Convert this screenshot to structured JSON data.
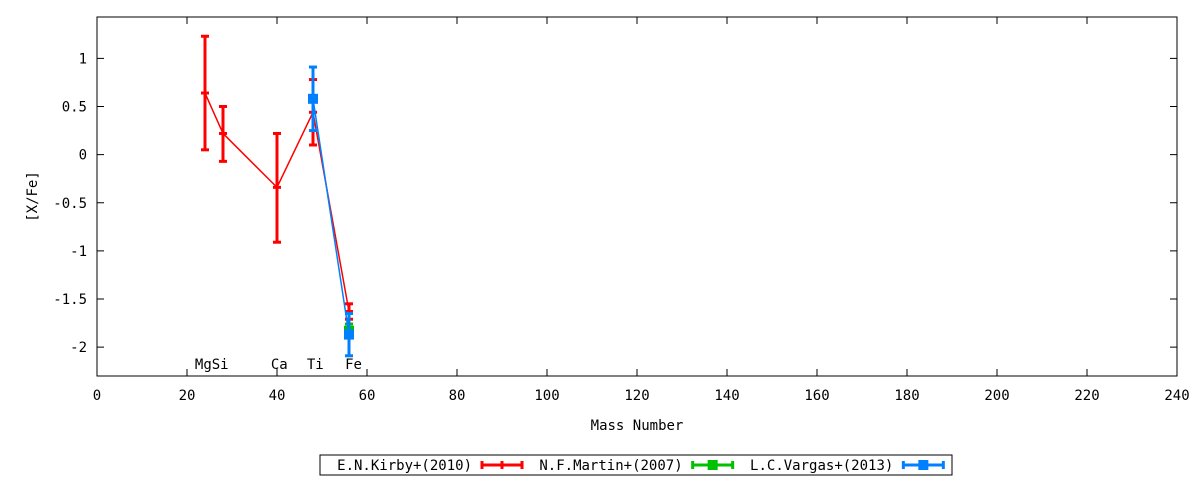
{
  "chart_data": {
    "type": "line",
    "xlabel": "Mass Number",
    "ylabel": "[X/Fe]",
    "xlim": [
      0,
      240
    ],
    "ylim": [
      -2.3,
      1.43
    ],
    "xticks": [
      0,
      20,
      40,
      60,
      80,
      100,
      120,
      140,
      160,
      180,
      200,
      220,
      240
    ],
    "yticks": [
      1,
      0.5,
      0,
      -0.5,
      -1,
      -1.5,
      -2
    ],
    "ytick_labels": [
      "1",
      "0.5",
      "0",
      "-0.5",
      "-1",
      "-1.5",
      "-2"
    ],
    "grid": false,
    "legend_placement": "bottom-center",
    "element_labels": [
      {
        "text": "MgSi",
        "x": 25.5
      },
      {
        "text": "Ca",
        "x": 40.5
      },
      {
        "text": "Ti",
        "x": 48.5
      },
      {
        "text": "Fe",
        "x": 57
      }
    ],
    "series": [
      {
        "name": "E.N.Kirby+(2010)",
        "color": "#ff0000",
        "marker": "bar",
        "points": [
          {
            "x": 24,
            "y": 0.64,
            "lo": 0.05,
            "hi": 1.23
          },
          {
            "x": 28,
            "y": 0.22,
            "lo": -0.07,
            "hi": 0.5
          },
          {
            "x": 40,
            "y": -0.34,
            "lo": -0.91,
            "hi": 0.22
          },
          {
            "x": 48,
            "y": 0.44,
            "lo": 0.1,
            "hi": 0.78
          },
          {
            "x": 56,
            "y": -1.63,
            "lo": -1.71,
            "hi": -1.55
          }
        ]
      },
      {
        "name": "N.F.Martin+(2007)",
        "color": "#00c000",
        "marker": "square",
        "points": [
          {
            "x": 56,
            "y": -1.83,
            "lo": -1.9,
            "hi": -1.76
          }
        ]
      },
      {
        "name": "L.C.Vargas+(2013)",
        "color": "#0080ff",
        "marker": "square",
        "points": [
          {
            "x": 48,
            "y": 0.58,
            "lo": 0.25,
            "hi": 0.91
          },
          {
            "x": 56,
            "y": -1.87,
            "lo": -2.09,
            "hi": -1.65
          }
        ]
      }
    ]
  }
}
